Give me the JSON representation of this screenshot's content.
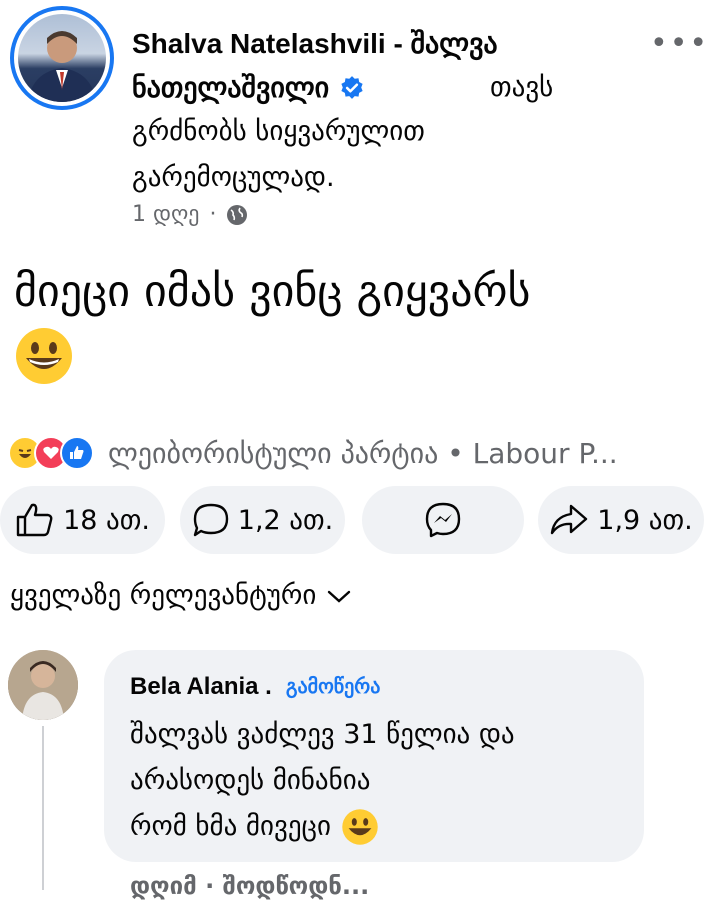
{
  "post": {
    "author": "Shalva Natelashvili -  შალვა",
    "author_line2": "ნათელაშვილი",
    "activity_1": "თავს",
    "activity_2": "გრძნობს სიყვარულით",
    "activity_3": "გარემოცულად.",
    "time": "1 დღე",
    "text": "მიეცი იმას ვინც გიყვარს",
    "more_icon": "more-horizontal-icon"
  },
  "reactions": {
    "page_text": "ლეიბორისტული პარტია • Labour P...",
    "icons": [
      "haha-reaction-icon",
      "love-reaction-icon",
      "like-reaction-icon"
    ]
  },
  "actions": {
    "like": "18 ათ.",
    "comment": "1,2 ათ.",
    "share": "1,9 ათ."
  },
  "comments": {
    "sort_label": "ყველაზე რელევანტური",
    "items": [
      {
        "name": "Bela Alania .",
        "follow": "გამოწერა",
        "line1": "შალვას ვაძლევ 31 წელია და",
        "line2": "არასოდეს მინანია",
        "line3": "რომ ხმა მივეცი"
      }
    ],
    "cutoff_text": "დღიმ · შოდწოდნ..."
  },
  "colors": {
    "accent": "#1877f2",
    "muted": "#65676b",
    "bubble": "#f0f2f5"
  }
}
